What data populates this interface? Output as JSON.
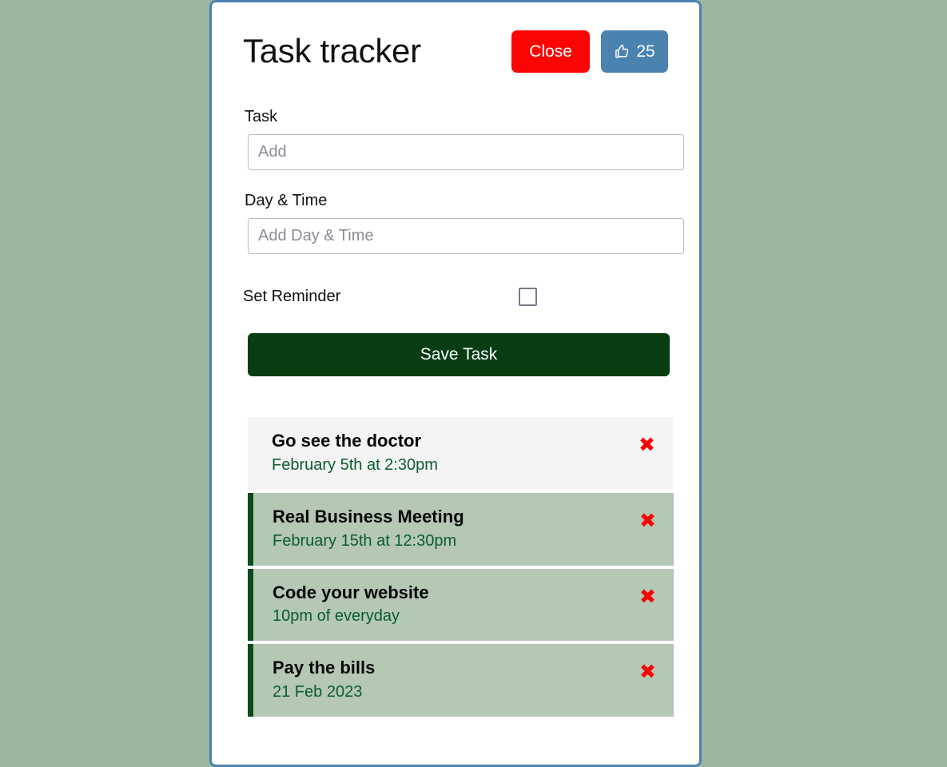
{
  "theme": {
    "page_background": "#9cb79e",
    "modal_border": "#4a82b0",
    "accent_red": "#fb0404",
    "accent_blue": "#4a82b0",
    "accent_green_dark": "#083d14",
    "list_marker_green": "#0a4a1d",
    "list_reminder_background": "#b4c8b4",
    "list_plain_background": "#f4f4f4",
    "meta_text_green": "#0b5c2e"
  },
  "header": {
    "title": "Task tracker",
    "close_label": "Close",
    "like_icon": "thumbs-up-icon",
    "like_count": "25"
  },
  "form": {
    "task_label": "Task",
    "task_value": "",
    "task_placeholder": "Add",
    "daytime_label": "Day & Time",
    "daytime_value": "",
    "daytime_placeholder": "Add Day & Time",
    "reminder_label": "Set Reminder",
    "reminder_checked": false,
    "save_label": "Save Task"
  },
  "tasks": [
    {
      "title": "Go see the doctor",
      "meta": "February 5th at 2:30pm",
      "reminder": false,
      "delete_icon": "✖"
    },
    {
      "title": "Real Business Meeting",
      "meta": "February 15th at 12:30pm",
      "reminder": true,
      "delete_icon": "✖"
    },
    {
      "title": "Code your website",
      "meta": "10pm of everyday",
      "reminder": true,
      "delete_icon": "✖"
    },
    {
      "title": "Pay the bills",
      "meta": "21 Feb 2023",
      "reminder": true,
      "delete_icon": "✖"
    }
  ]
}
